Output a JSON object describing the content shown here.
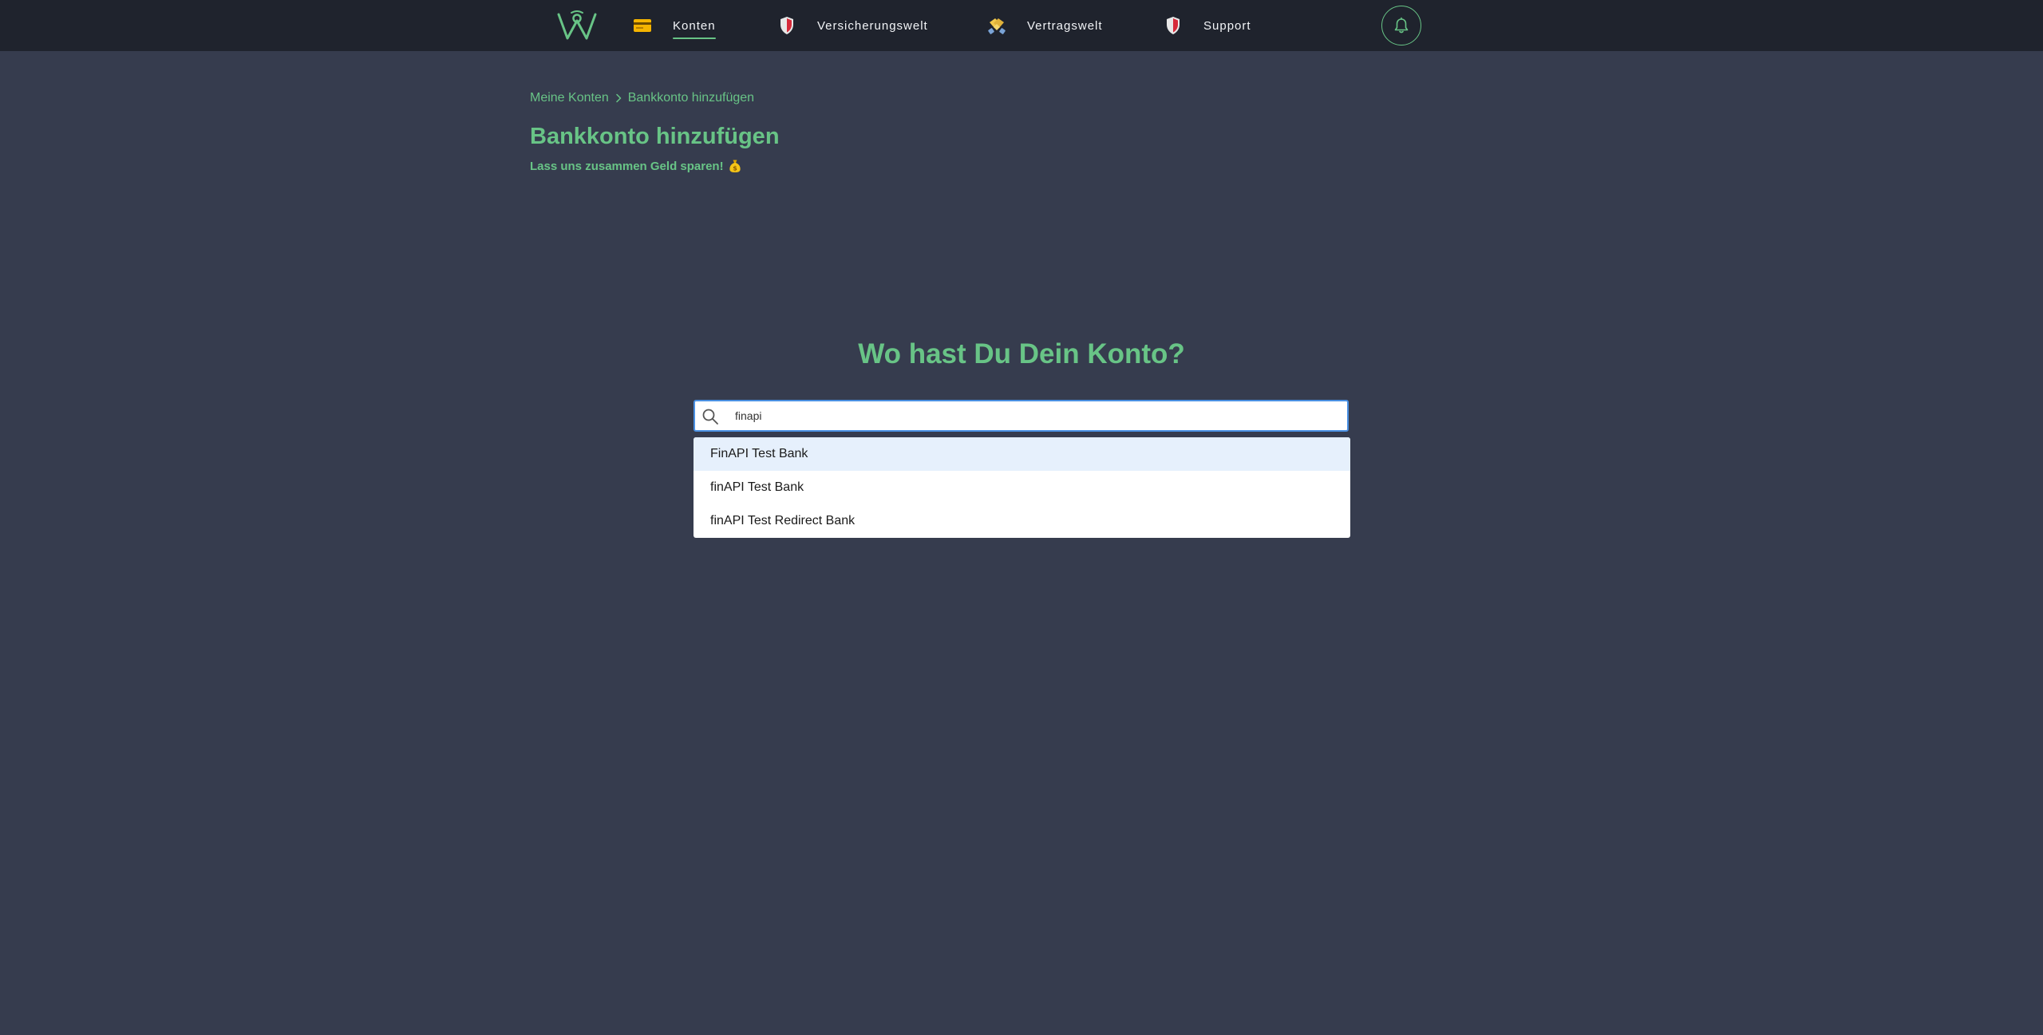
{
  "nav": {
    "items": [
      {
        "label": "Konten",
        "icon": "credit-card-icon",
        "active": true
      },
      {
        "label": "Versicherungswelt",
        "icon": "shield-icon"
      },
      {
        "label": "Vertragswelt",
        "icon": "handshake-icon"
      },
      {
        "label": "Support",
        "icon": "shield-icon"
      }
    ],
    "logo": "wunder-logo",
    "notification_icon": "bell-icon"
  },
  "breadcrumb": {
    "items": [
      "Meine Konten",
      "Bankkonto hinzufügen"
    ]
  },
  "header": {
    "title": "Bankkonto hinzufügen",
    "subtitle": "Lass uns zusammen Geld sparen!",
    "subtitle_icon": "money-bag-icon"
  },
  "search": {
    "question": "Wo hast Du Dein Konto?",
    "value": "finapi",
    "results": [
      "FinAPI Test Bank",
      "finAPI Test Bank",
      "finAPI Test Redirect Bank"
    ]
  },
  "colors": {
    "background": "#363c4e",
    "navbar": "#1f232d",
    "accent": "#68c486",
    "input_border": "#4a90e2",
    "highlight": "#e6f0fc"
  }
}
